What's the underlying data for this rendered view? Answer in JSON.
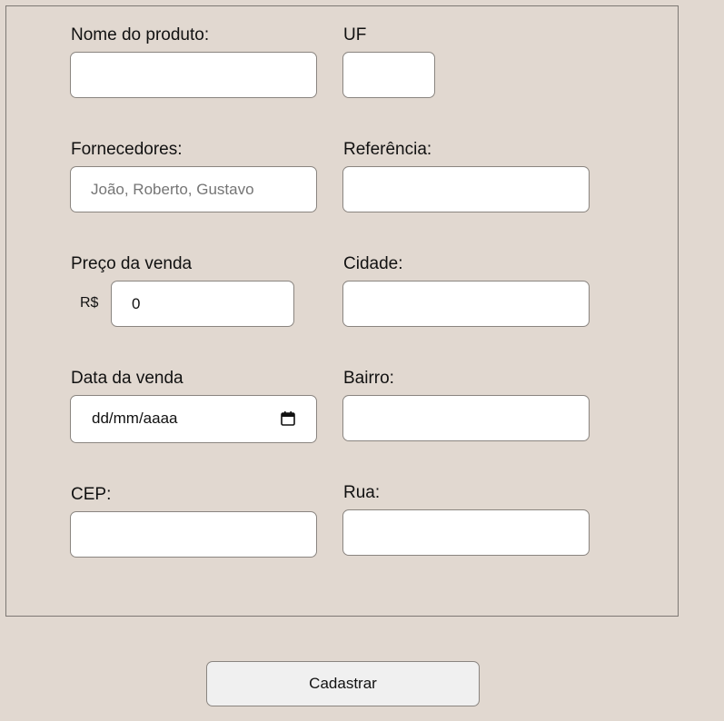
{
  "form": {
    "nome_produto": {
      "label": "Nome do produto:",
      "value": "",
      "placeholder": ""
    },
    "uf": {
      "label": "UF",
      "value": "",
      "placeholder": ""
    },
    "fornecedores": {
      "label": "Fornecedores:",
      "value": "",
      "placeholder": "João, Roberto, Gustavo"
    },
    "referencia": {
      "label": "Referência:",
      "value": "",
      "placeholder": ""
    },
    "preco_venda": {
      "label": "Preço da venda",
      "prefix": "R$",
      "value": "0"
    },
    "cidade": {
      "label": "Cidade:",
      "value": "",
      "placeholder": ""
    },
    "data_venda": {
      "label": "Data da venda",
      "value_display": "dd/mm/aaaa",
      "icon": "calendar-icon"
    },
    "bairro": {
      "label": "Bairro:",
      "value": "",
      "placeholder": ""
    },
    "cep": {
      "label": "CEP:",
      "value": "",
      "placeholder": ""
    },
    "rua": {
      "label": "Rua:",
      "value": "",
      "placeholder": ""
    }
  },
  "actions": {
    "submit_label": "Cadastrar"
  }
}
